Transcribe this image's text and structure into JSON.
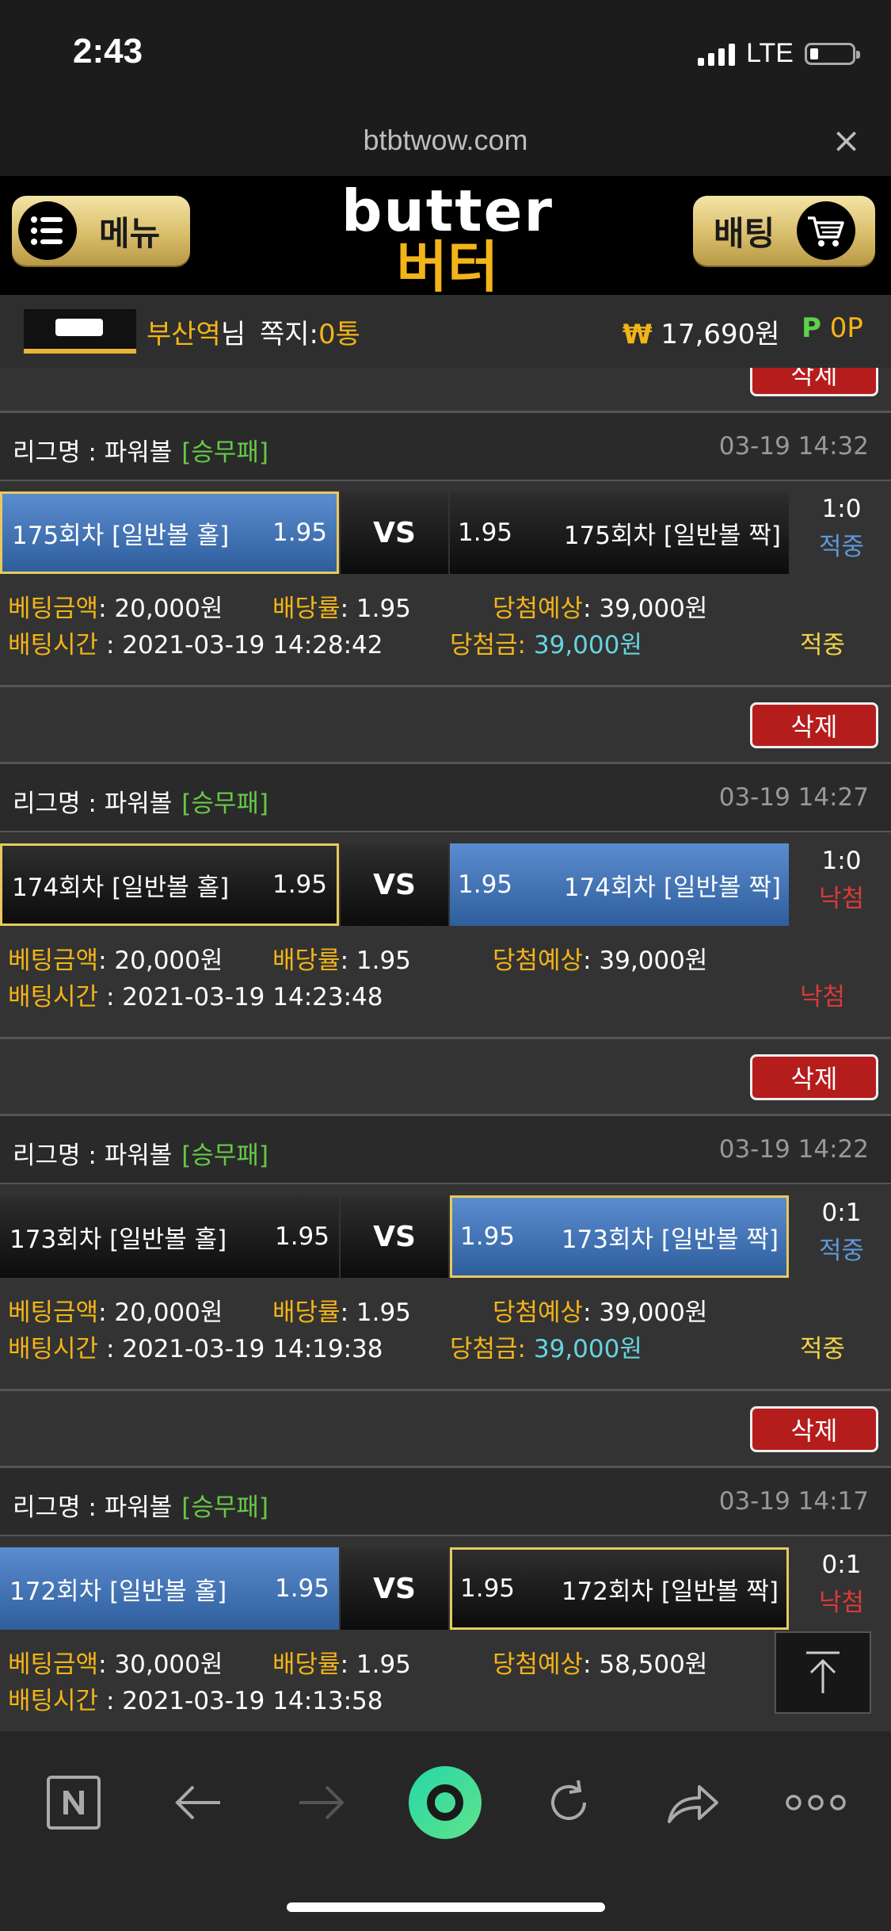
{
  "status_bar": {
    "time": "2:43",
    "network": "LTE"
  },
  "browser": {
    "url": "btbtwow.com",
    "close_label": "×"
  },
  "header": {
    "menu_label": "메뉴",
    "bet_label": "배팅",
    "logo_en": "butter",
    "logo_ko": "버터"
  },
  "user": {
    "name": "부산역",
    "name_suffix": "님",
    "msg_label": "쪽지:",
    "msg_count": "0통",
    "currency_symbol": "₩",
    "balance": "17,690원",
    "points_symbol": "P",
    "points": "0P"
  },
  "top_partial_delete_label": "삭제",
  "bets": [
    {
      "delete_label": "삭제",
      "league_label": "리그명 : 파워볼",
      "league_tag": "[승무패]",
      "date": "03-19 14:32",
      "home_team": "175회차 [일반볼 홀]",
      "home_odds": "1.95",
      "vs": "VS",
      "away_odds": "1.95",
      "away_team": "175회차 [일반볼 짝]",
      "score": "1:0",
      "result": "적중",
      "amount_label": "베팅금액",
      "amount": ": 20,000원",
      "rate_label": "배당률",
      "rate": ": 1.95",
      "expected_label": "당첨예상",
      "expected": ": 39,000원",
      "time_label": "배팅시간",
      "time": " : 2021-03-19 14:28:42",
      "winnings_label": "당첨금:",
      "winnings": "39,000원",
      "status": "적중"
    },
    {
      "delete_label": "삭제",
      "league_label": "리그명 : 파워볼",
      "league_tag": "[승무패]",
      "date": "03-19 14:27",
      "home_team": "174회차 [일반볼 홀]",
      "home_odds": "1.95",
      "vs": "VS",
      "away_odds": "1.95",
      "away_team": "174회차 [일반볼 짝]",
      "score": "1:0",
      "result": "낙첨",
      "amount_label": "베팅금액",
      "amount": ": 20,000원",
      "rate_label": "배당률",
      "rate": ": 1.95",
      "expected_label": "당첨예상",
      "expected": ": 39,000원",
      "time_label": "배팅시간",
      "time": " : 2021-03-19 14:23:48",
      "winnings_label": "",
      "winnings": "",
      "status": "낙첨"
    },
    {
      "delete_label": "삭제",
      "league_label": "리그명 : 파워볼",
      "league_tag": "[승무패]",
      "date": "03-19 14:22",
      "home_team": "173회차 [일반볼 홀]",
      "home_odds": "1.95",
      "vs": "VS",
      "away_odds": "1.95",
      "away_team": "173회차 [일반볼 짝]",
      "score": "0:1",
      "result": "적중",
      "amount_label": "베팅금액",
      "amount": ": 20,000원",
      "rate_label": "배당률",
      "rate": ": 1.95",
      "expected_label": "당첨예상",
      "expected": ": 39,000원",
      "time_label": "배팅시간",
      "time": " : 2021-03-19 14:19:38",
      "winnings_label": "당첨금:",
      "winnings": "39,000원",
      "status": "적중"
    },
    {
      "delete_label": "삭제",
      "league_label": "리그명 : 파워볼",
      "league_tag": "[승무패]",
      "date": "03-19 14:17",
      "home_team": "172회차 [일반볼 홀]",
      "home_odds": "1.95",
      "vs": "VS",
      "away_odds": "1.95",
      "away_team": "172회차 [일반볼 짝]",
      "score": "0:1",
      "result": "낙첨",
      "amount_label": "베팅금액",
      "amount": ": 30,000원",
      "rate_label": "배당률",
      "rate": ": 1.95",
      "expected_label": "당첨예상",
      "expected": ": 58,500원",
      "time_label": "배팅시간",
      "time": " : 2021-03-19 14:13:58",
      "winnings_label": "",
      "winnings": "",
      "status": ""
    }
  ],
  "colors": {
    "gold": "#f2b418",
    "blue_selection": "#4a7cc0",
    "win_blue": "#5a9ad8",
    "lose_red": "#d93a3a",
    "delete_red": "#b51d1d",
    "tag_green": "#66c94a",
    "winnings_cyan": "#66d4e0"
  },
  "bottom_nav": {
    "icons": [
      "naver-n-icon",
      "back-arrow-icon",
      "forward-arrow-icon",
      "home-circle-icon",
      "refresh-icon",
      "share-icon",
      "more-icon"
    ]
  }
}
